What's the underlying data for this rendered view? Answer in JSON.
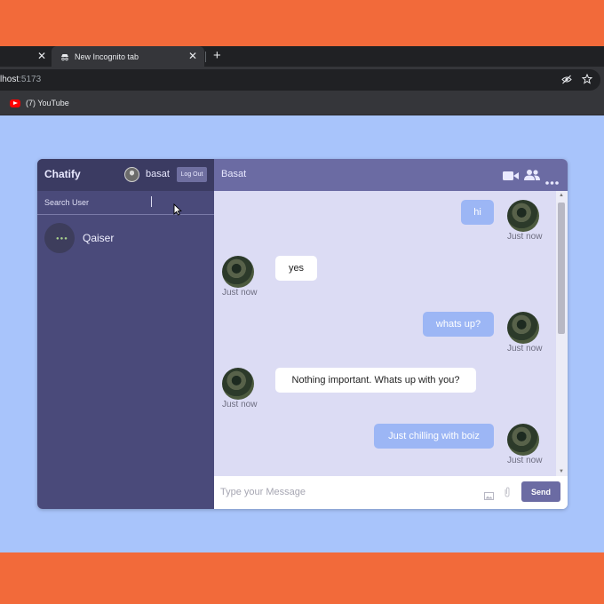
{
  "browser": {
    "tabs": [
      {
        "label": ""
      },
      {
        "label": "New Incognito tab"
      }
    ],
    "new_tab": "+",
    "url_host": "lhost",
    "url_port": ":5173",
    "bookmark": "(7) YouTube"
  },
  "app": {
    "brand": "Chatify",
    "current_user": "basat",
    "logout_label": "Log Out",
    "search_placeholder": "Search User",
    "contacts": [
      {
        "name": "Qaiser"
      }
    ],
    "chat_title": "Basat",
    "messages": [
      {
        "text": "hi",
        "direction": "out",
        "time": "Just now"
      },
      {
        "text": "yes",
        "direction": "in",
        "time": "Just now"
      },
      {
        "text": "whats up?",
        "direction": "out",
        "time": "Just now"
      },
      {
        "text": "Nothing important. Whats up with you?",
        "direction": "in",
        "time": "Just now"
      },
      {
        "text": "Just chilling with boiz",
        "direction": "out",
        "time": "Just now"
      }
    ],
    "composer_placeholder": "Type your Message",
    "send_label": "Send"
  },
  "colors": {
    "page_background": "#f26a3a",
    "browser_background": "#a8c4fb",
    "sidebar": "#4a4a7a",
    "header": "#6b6ba3",
    "outgoing_bubble": "#9cb6f5",
    "incoming_bubble": "#ffffff"
  }
}
